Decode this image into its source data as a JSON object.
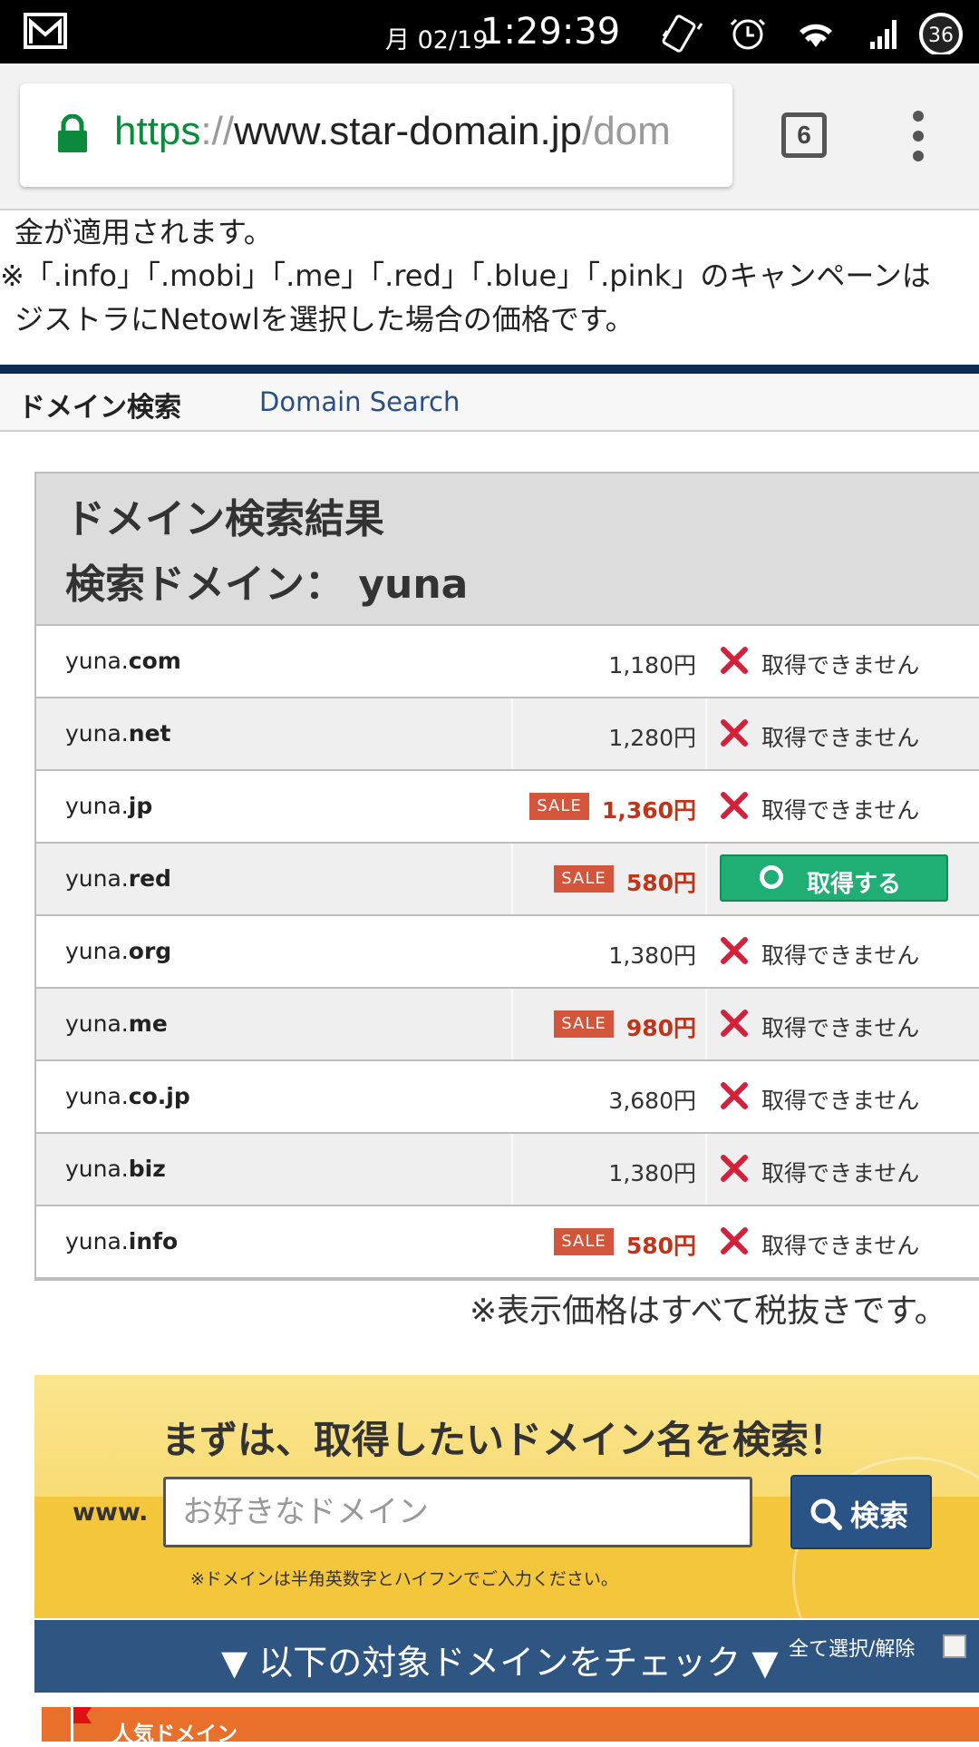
{
  "status_bar": {
    "date": "月 02/19",
    "time": "1:29:39",
    "battery": "36"
  },
  "browser": {
    "url_scheme": "https",
    "url_sep": "://",
    "url_host": "www.star-domain.jp",
    "url_path": "/dom",
    "tab_count": "6"
  },
  "notice": {
    "line1": "金が適用されます。",
    "line2": "※「.info」「.mobi」「.me」「.red」「.blue」「.pink」のキャンペーンは",
    "line3": "ジストラにNetowlを選択した場合の価格です。"
  },
  "subhead": {
    "jp": "ドメイン検索",
    "en": "Domain Search"
  },
  "results": {
    "title": "ドメイン検索結果",
    "query_label": "検索ドメイン： yuna",
    "sale_badge": "SALE",
    "unavailable": "取得できません",
    "get_label": "取得する",
    "rows": [
      {
        "name": "yuna.",
        "tld": "com",
        "price": "1,180円",
        "sale": false,
        "available": false
      },
      {
        "name": "yuna.",
        "tld": "net",
        "price": "1,280円",
        "sale": false,
        "available": false
      },
      {
        "name": "yuna.",
        "tld": "jp",
        "price": "1,360円",
        "sale": true,
        "available": false
      },
      {
        "name": "yuna.",
        "tld": "red",
        "price": "580円",
        "sale": true,
        "available": true
      },
      {
        "name": "yuna.",
        "tld": "org",
        "price": "1,380円",
        "sale": false,
        "available": false
      },
      {
        "name": "yuna.",
        "tld": "me",
        "price": "980円",
        "sale": true,
        "available": false
      },
      {
        "name": "yuna.",
        "tld": "co.jp",
        "price": "3,680円",
        "sale": false,
        "available": false
      },
      {
        "name": "yuna.",
        "tld": "biz",
        "price": "1,380円",
        "sale": false,
        "available": false
      },
      {
        "name": "yuna.",
        "tld": "info",
        "price": "580円",
        "sale": true,
        "available": false
      }
    ]
  },
  "tax_note": "※表示価格はすべて税抜きです。",
  "search": {
    "headline": "まずは、取得したいドメイン名を検索！",
    "www": "www.",
    "placeholder": "お好きなドメイン",
    "button": "検索",
    "hint": "※ドメインは半角英数字とハイフンでご入力ください。"
  },
  "check_bar": {
    "label": "▼ 以下の対象ドメインをチェック ▼",
    "select_all": "全て選択/解除"
  },
  "popular": {
    "label": "人気ドメイン"
  }
}
